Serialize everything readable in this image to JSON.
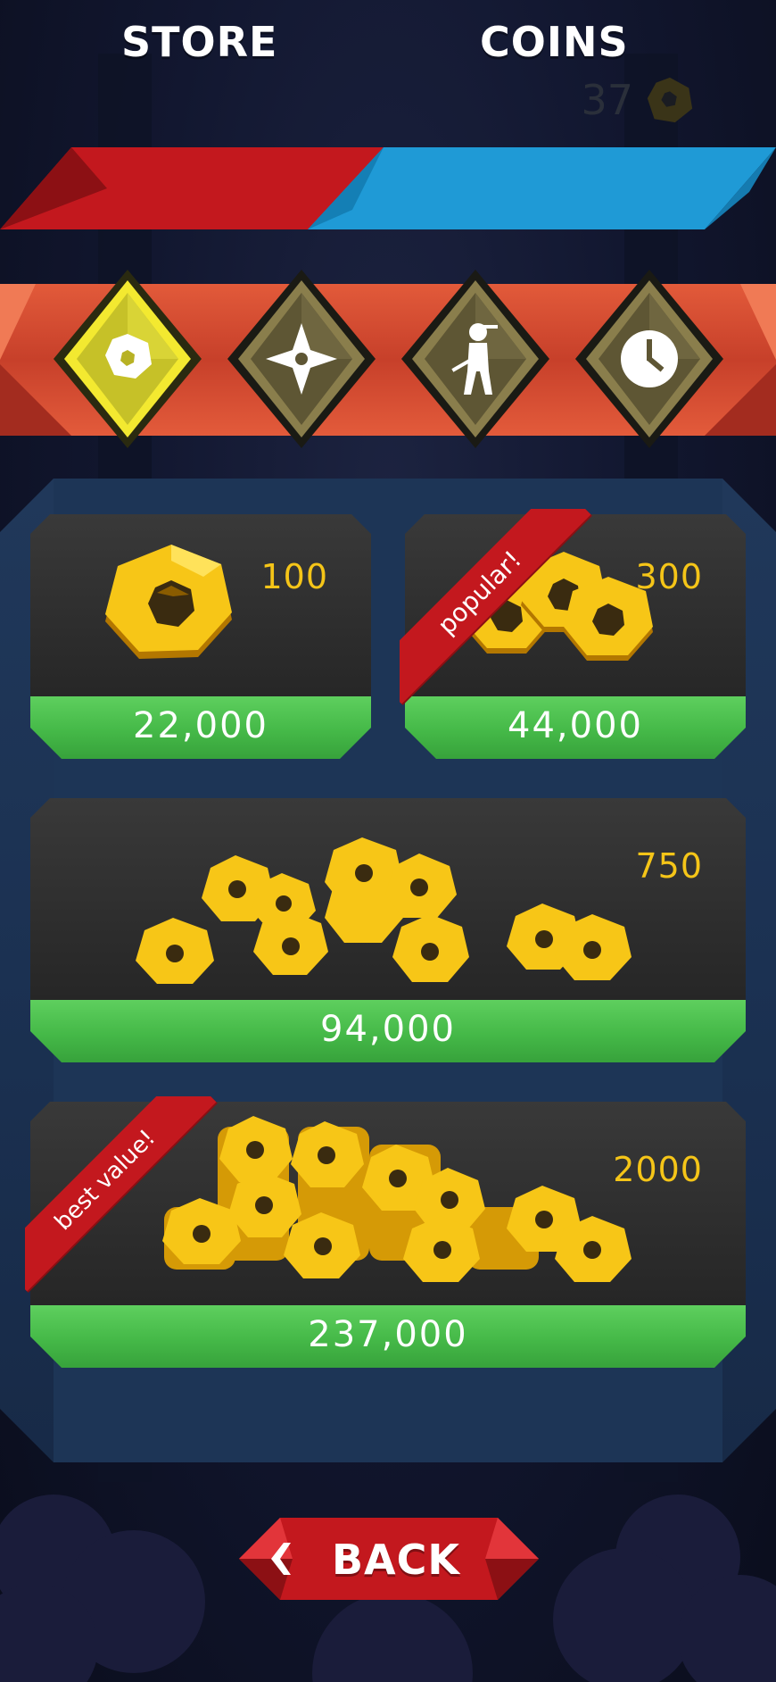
{
  "hud": {
    "coin_count": "37",
    "coin_icon": "coin-icon"
  },
  "header": {
    "store_label": "STORE",
    "coins_label": "COINS"
  },
  "categories": [
    {
      "id": "coins",
      "icon": "coin-icon",
      "selected": true
    },
    {
      "id": "shuriken",
      "icon": "shuriken-icon",
      "selected": false
    },
    {
      "id": "characters",
      "icon": "ninja-character-icon",
      "selected": false
    },
    {
      "id": "time",
      "icon": "clock-icon",
      "selected": false
    }
  ],
  "packs": [
    {
      "amount": "100",
      "price": "22,000",
      "badge": ""
    },
    {
      "amount": "300",
      "price": "44,000",
      "badge": "popular!"
    },
    {
      "amount": "750",
      "price": "94,000",
      "badge": ""
    },
    {
      "amount": "2000",
      "price": "237,000",
      "badge": "best value!"
    }
  ],
  "footer": {
    "back_label": "BACK",
    "back_icon": "chevron-left-icon"
  },
  "colors": {
    "store_red": "#c3181e",
    "coins_blue": "#1f9ad6",
    "price_green": "#45b948",
    "amount_gold": "#f5c518",
    "panel_blue": "#1d3556"
  }
}
